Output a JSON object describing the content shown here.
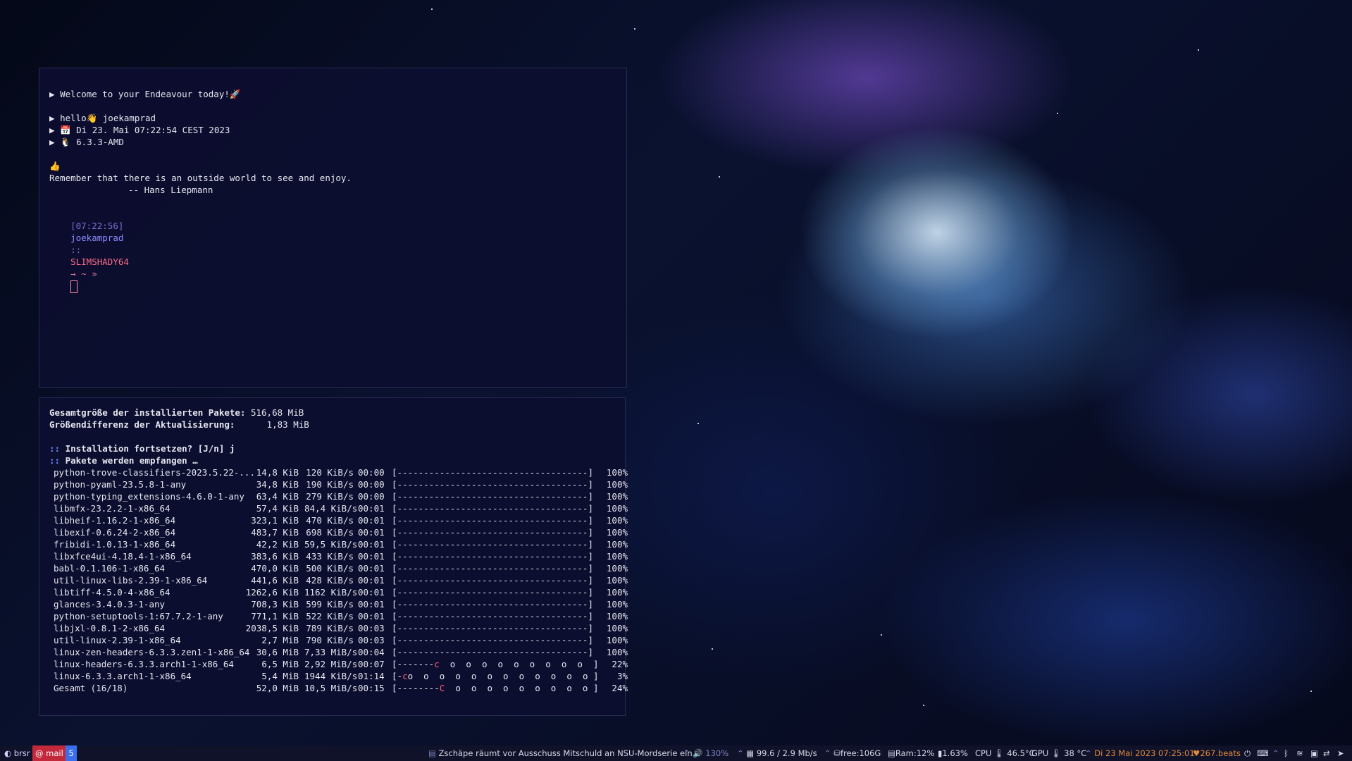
{
  "terminal_top": {
    "welcome": "Welcome to your Endeavour today!🚀",
    "hello": "hello👋 joekamprad",
    "date": "📅 Di 23. Mai 07:22:54 CEST 2023",
    "kernel": "🐧 6.3.3-AMD",
    "fortune_icon": "👍",
    "fortune_text": "Remember that there is an outside world to see and enjoy.",
    "fortune_author": "-- Hans Liepmann",
    "prompt": {
      "time": "[07:22:56]",
      "user": "joekamprad",
      "sep": "::",
      "host": "SLIMSHADY64",
      "path": "→ ~ »"
    }
  },
  "terminal_bottom": {
    "total_size_label": "Gesamtgröße der installierten Pakete:",
    "total_size_value": "516,68 MiB",
    "diff_label": "Größendifferenz der Aktualisierung:",
    "diff_value": "1,83 MiB",
    "confirm": "Installation fortsetzen? [J/n] j",
    "receiving": "Pakete werden empfangen …",
    "packages": [
      {
        "name": "python-trove-classifiers-2023.5.22-...",
        "size": "14,8 KiB",
        "rate": "120 KiB/s",
        "time": "00:00",
        "bar": "[------------------------------------]",
        "pct": "100%"
      },
      {
        "name": "python-pyaml-23.5.8-1-any",
        "size": "34,8 KiB",
        "rate": "190 KiB/s",
        "time": "00:00",
        "bar": "[------------------------------------]",
        "pct": "100%"
      },
      {
        "name": "python-typing_extensions-4.6.0-1-any",
        "size": "63,4 KiB",
        "rate": "279 KiB/s",
        "time": "00:00",
        "bar": "[------------------------------------]",
        "pct": "100%"
      },
      {
        "name": "libmfx-23.2.2-1-x86_64",
        "size": "57,4 KiB",
        "rate": "84,4 KiB/s",
        "time": "00:01",
        "bar": "[------------------------------------]",
        "pct": "100%"
      },
      {
        "name": "libheif-1.16.2-1-x86_64",
        "size": "323,1 KiB",
        "rate": "470 KiB/s",
        "time": "00:01",
        "bar": "[------------------------------------]",
        "pct": "100%"
      },
      {
        "name": "libexif-0.6.24-2-x86_64",
        "size": "483,7 KiB",
        "rate": "698 KiB/s",
        "time": "00:01",
        "bar": "[------------------------------------]",
        "pct": "100%"
      },
      {
        "name": "fribidi-1.0.13-1-x86_64",
        "size": "42,2 KiB",
        "rate": "59,5 KiB/s",
        "time": "00:01",
        "bar": "[------------------------------------]",
        "pct": "100%"
      },
      {
        "name": "libxfce4ui-4.18.4-1-x86_64",
        "size": "383,6 KiB",
        "rate": "433 KiB/s",
        "time": "00:01",
        "bar": "[------------------------------------]",
        "pct": "100%"
      },
      {
        "name": "babl-0.1.106-1-x86_64",
        "size": "470,0 KiB",
        "rate": "500 KiB/s",
        "time": "00:01",
        "bar": "[------------------------------------]",
        "pct": "100%"
      },
      {
        "name": "util-linux-libs-2.39-1-x86_64",
        "size": "441,6 KiB",
        "rate": "428 KiB/s",
        "time": "00:01",
        "bar": "[------------------------------------]",
        "pct": "100%"
      },
      {
        "name": "libtiff-4.5.0-4-x86_64",
        "size": "1262,6 KiB",
        "rate": "1162 KiB/s",
        "time": "00:01",
        "bar": "[------------------------------------]",
        "pct": "100%"
      },
      {
        "name": "glances-3.4.0.3-1-any",
        "size": "708,3 KiB",
        "rate": "599 KiB/s",
        "time": "00:01",
        "bar": "[------------------------------------]",
        "pct": "100%"
      },
      {
        "name": "python-setuptools-1:67.7.2-1-any",
        "size": "771,1 KiB",
        "rate": "522 KiB/s",
        "time": "00:01",
        "bar": "[------------------------------------]",
        "pct": "100%"
      },
      {
        "name": "libjxl-0.8.1-2-x86_64",
        "size": "2038,5 KiB",
        "rate": "789 KiB/s",
        "time": "00:03",
        "bar": "[------------------------------------]",
        "pct": "100%"
      },
      {
        "name": "util-linux-2.39-1-x86_64",
        "size": "2,7 MiB",
        "rate": "790 KiB/s",
        "time": "00:03",
        "bar": "[------------------------------------]",
        "pct": "100%"
      },
      {
        "name": "linux-zen-headers-6.3.3.zen1-1-x86_64",
        "size": "30,6 MiB",
        "rate": "7,33 MiB/s",
        "time": "00:04",
        "bar": "[------------------------------------]",
        "pct": "100%"
      },
      {
        "name": "linux-headers-6.3.3.arch1-1-x86_64",
        "size": "6,5 MiB",
        "rate": "2,92 MiB/s",
        "time": "00:07",
        "bar": "[-------c  o  o  o  o  o  o  o  o  o  ]",
        "pct": "22%"
      },
      {
        "name": "linux-6.3.3.arch1-1-x86_64",
        "size": "5,4 MiB",
        "rate": "1944 KiB/s",
        "time": "01:14",
        "bar": "[-co  o  o  o  o  o  o  o  o  o  o  o ]",
        "pct": "3%"
      },
      {
        "name": "Gesamt (16/18)",
        "size": "52,0 MiB",
        "rate": "10,5 MiB/s",
        "time": "00:15",
        "bar": "[--------C  o  o  o  o  o  o  o  o  o ]",
        "pct": "24%"
      }
    ]
  },
  "taskbar": {
    "workspaces": [
      {
        "label": "brsr"
      },
      {
        "label": "mail"
      },
      {
        "label": "5"
      }
    ],
    "news": "Zschäpe räumt vor Ausschuss Mitschuld an NSU-Mordserie ein",
    "volume": "130%",
    "network": "99.6 / 2.9 Mb/s",
    "disk": "free:106G",
    "ram": "Ram:12%",
    "cpu_load": "1.63%",
    "cpu_temp": "CPU 🌡 46.5°C",
    "gpu_temp": "GPU 🌡 38 °C",
    "datetime": "Di 23 Mai 2023 07:25:01",
    "beats": "267.beats"
  }
}
